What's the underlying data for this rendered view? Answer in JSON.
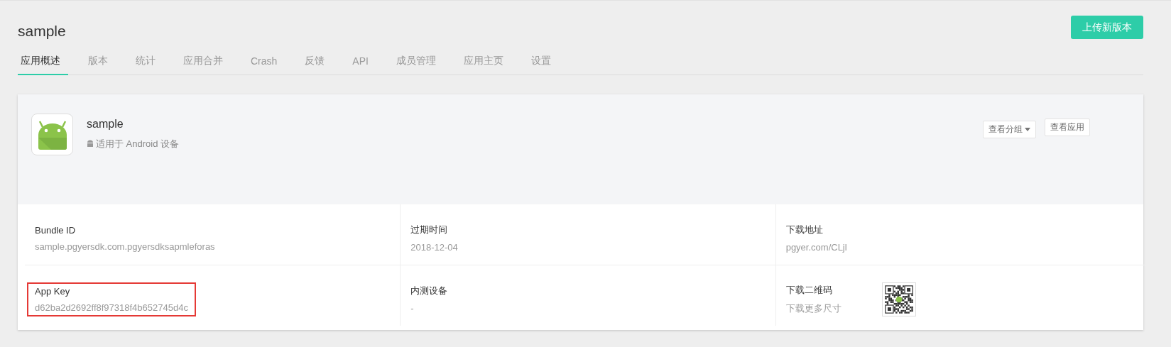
{
  "app_title": "sample",
  "upload_button": "上传新版本",
  "tabs": [
    {
      "label": "应用概述",
      "selected": true
    },
    {
      "label": "版本",
      "selected": false
    },
    {
      "label": "统计",
      "selected": false
    },
    {
      "label": "应用合并",
      "selected": false
    },
    {
      "label": "Crash",
      "selected": false
    },
    {
      "label": "反馈",
      "selected": false
    },
    {
      "label": "API",
      "selected": false
    },
    {
      "label": "成员管理",
      "selected": false
    },
    {
      "label": "应用主页",
      "selected": false
    },
    {
      "label": "设置",
      "selected": false
    }
  ],
  "app_card": {
    "name": "sample",
    "platform": "适用于 Android 设备",
    "group_button": "查看分组",
    "view_button": "查看应用"
  },
  "fields": [
    {
      "kind": "text",
      "label": "Bundle ID",
      "value": "sample.pgyersdk.com.pgyersdksapmleforas",
      "highlighted": false
    },
    {
      "kind": "text",
      "label": "过期时间",
      "value": "2018-12-04",
      "highlighted": false
    },
    {
      "kind": "text",
      "label": "下载地址",
      "value": "pgyer.com/CLjl",
      "highlighted": false
    },
    {
      "kind": "text",
      "label": "App Key",
      "value": "d62ba2d2692ff8f97318f4b652745d4c",
      "highlighted": true
    },
    {
      "kind": "text",
      "label": "内测设备",
      "value": "-",
      "highlighted": false
    },
    {
      "kind": "qr",
      "label": "下载二维码",
      "value": "下载更多尺寸",
      "highlighted": false
    }
  ]
}
